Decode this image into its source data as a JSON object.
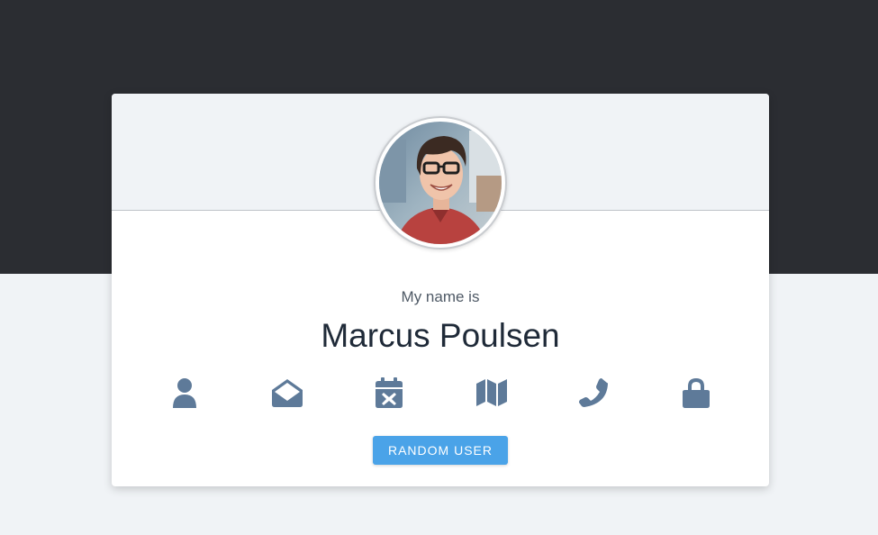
{
  "card": {
    "subtitle": "My name is",
    "value": "Marcus Poulsen",
    "random_button_label": "RANDOM USER"
  },
  "icons": [
    {
      "name": "user-icon",
      "label": "name"
    },
    {
      "name": "envelope-open-icon",
      "label": "email"
    },
    {
      "name": "calendar-x-icon",
      "label": "birthday"
    },
    {
      "name": "map-icon",
      "label": "address"
    },
    {
      "name": "phone-icon",
      "label": "phone"
    },
    {
      "name": "lock-icon",
      "label": "password"
    }
  ],
  "colors": {
    "top_band": "#2b2d32",
    "page_background": "#f0f3f6",
    "icon": "#5e7a99",
    "button": "#4aa3e8"
  }
}
